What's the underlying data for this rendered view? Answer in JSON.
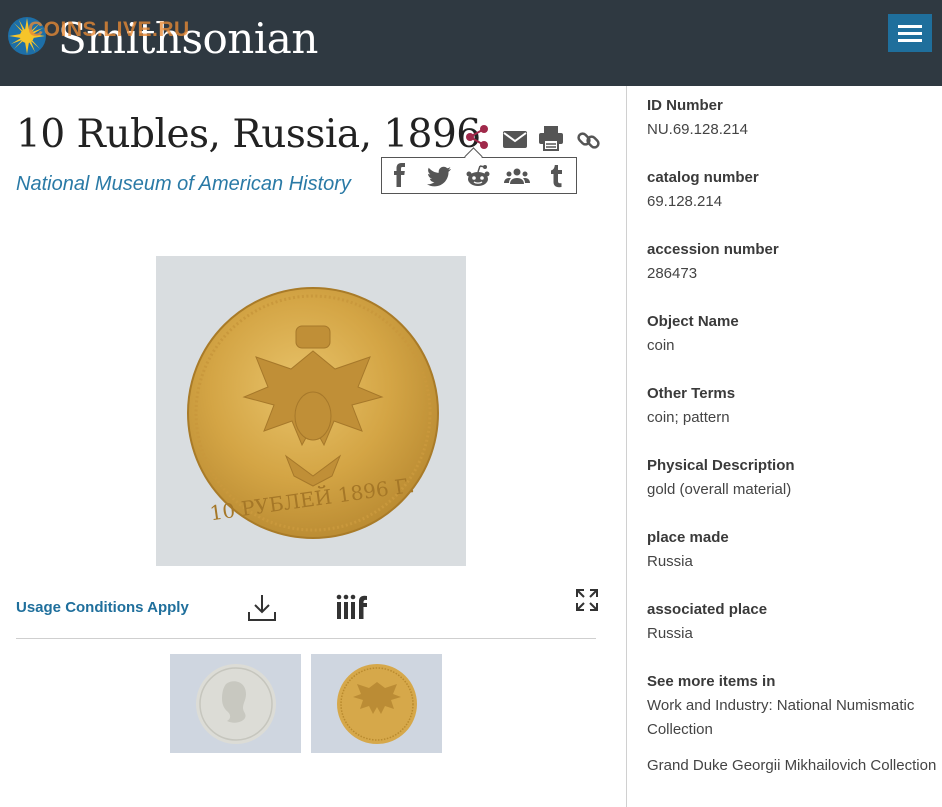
{
  "header": {
    "brand": "Smithsonian",
    "watermark": "COINS.LIVE.RU",
    "icons": {
      "logo": "sunburst-logo-icon",
      "menu": "hamburger-menu-icon"
    }
  },
  "object": {
    "title": "10 Rubles, Russia, 1896",
    "museum": "National Museum of American History",
    "image_alt": "Gold coin, reverse with double-headed eagle, 10 РУБЛЕЙ 1896 Г."
  },
  "tools": {
    "icons": [
      "share-icon",
      "email-icon",
      "print-icon",
      "link-icon"
    ],
    "share_menu": [
      "facebook-icon",
      "twitter-icon",
      "reddit-icon",
      "people-icon",
      "tumblr-icon"
    ]
  },
  "media": {
    "usage_label": "Usage Conditions Apply",
    "icons": {
      "download": "download-icon",
      "iiif": "iiif-icon",
      "expand": "expand-icon"
    }
  },
  "details": {
    "id_number": {
      "label": "ID Number",
      "value": "NU.69.128.214"
    },
    "catalog_number": {
      "label": "catalog number",
      "value": "69.128.214"
    },
    "accession_number": {
      "label": "accession number",
      "value": "286473"
    },
    "object_name": {
      "label": "Object Name",
      "value": "coin"
    },
    "other_terms": {
      "label": "Other Terms",
      "value": "coin; pattern"
    },
    "physical_description": {
      "label": "Physical Description",
      "value": "gold (overall material)"
    },
    "place_made": {
      "label": "place made",
      "value": "Russia"
    },
    "associated_place": {
      "label": "associated place",
      "value": "Russia"
    },
    "see_more": {
      "label": "See more items in",
      "items": [
        "Work and Industry: National Numismatic Collection",
        "Grand Duke Georgii Mikhailovich Collection"
      ]
    }
  },
  "colors": {
    "header_bg": "#2f3941",
    "menu_bg": "#1f6f9c",
    "link": "#2a7aa6",
    "share_active": "#a0294a"
  }
}
